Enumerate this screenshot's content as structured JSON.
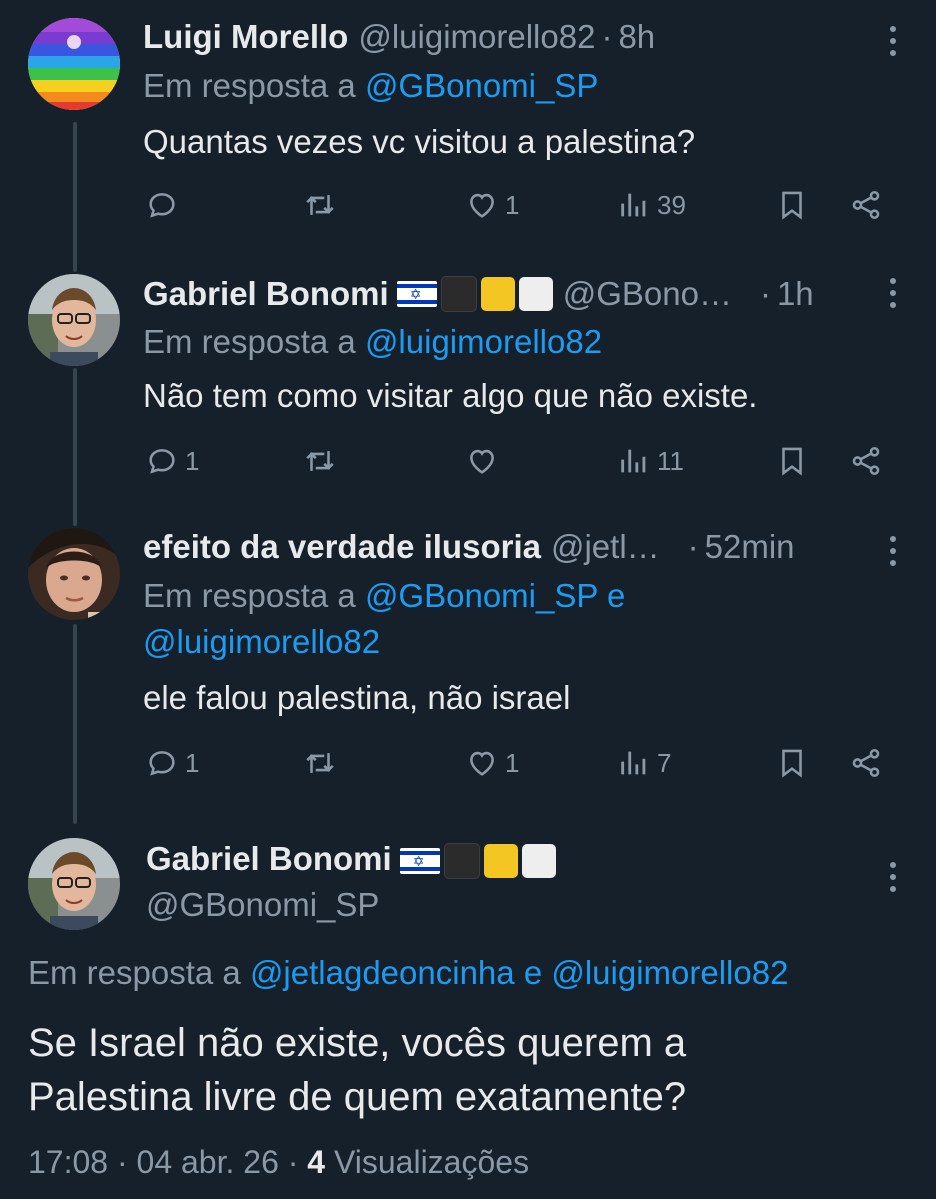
{
  "colors": {
    "background": "#15202b",
    "text": "#e7e9ea",
    "muted": "#8b98a5",
    "link": "#1d9bf0",
    "thread_line": "#38444d"
  },
  "tweets": [
    {
      "name": "Luigi Morello",
      "handle": "@luigimorello82",
      "time": "8h",
      "reply_prefix": "Em resposta a",
      "reply_to": "@GBonomi_SP",
      "text": "Quantas vezes vc visitou a palestina?",
      "replies": "",
      "likes": "1",
      "views": "39"
    },
    {
      "name": "Gabriel Bonomi",
      "handle": "@GBono…",
      "time": "1h",
      "reply_prefix": "Em resposta a",
      "reply_to": "@luigimorello82",
      "text": "Não tem como visitar algo que não existe.",
      "replies": "1",
      "likes": "",
      "views": "11"
    },
    {
      "name": "efeito da verdade ilusoria",
      "handle": "@jetl…",
      "time": "52min",
      "reply_prefix": "Em resposta a",
      "reply_to": "@GBonomi_SP",
      "reply_join": "e",
      "reply_to_2": "@luigimorello82",
      "text": "ele falou palestina, não israel",
      "replies": "1",
      "likes": "1",
      "views": "7"
    }
  ],
  "main": {
    "name": "Gabriel Bonomi",
    "handle": "@GBonomi_SP",
    "reply_prefix": "Em resposta a",
    "reply_to": "@jetlagdeoncinha",
    "reply_join": "e",
    "reply_to_2": "@luigimorello82",
    "text_line1": "Se Israel não existe, vocês querem a",
    "text_line2": "Palestina livre de quem exatamente?",
    "time": "17:08",
    "date": "04 abr. 26",
    "views_count": "4",
    "views_label": "Visualizações"
  },
  "icons": [
    "reply-icon",
    "retweet-icon",
    "like-icon",
    "views-icon",
    "bookmark-icon",
    "share-icon",
    "more-icon"
  ]
}
